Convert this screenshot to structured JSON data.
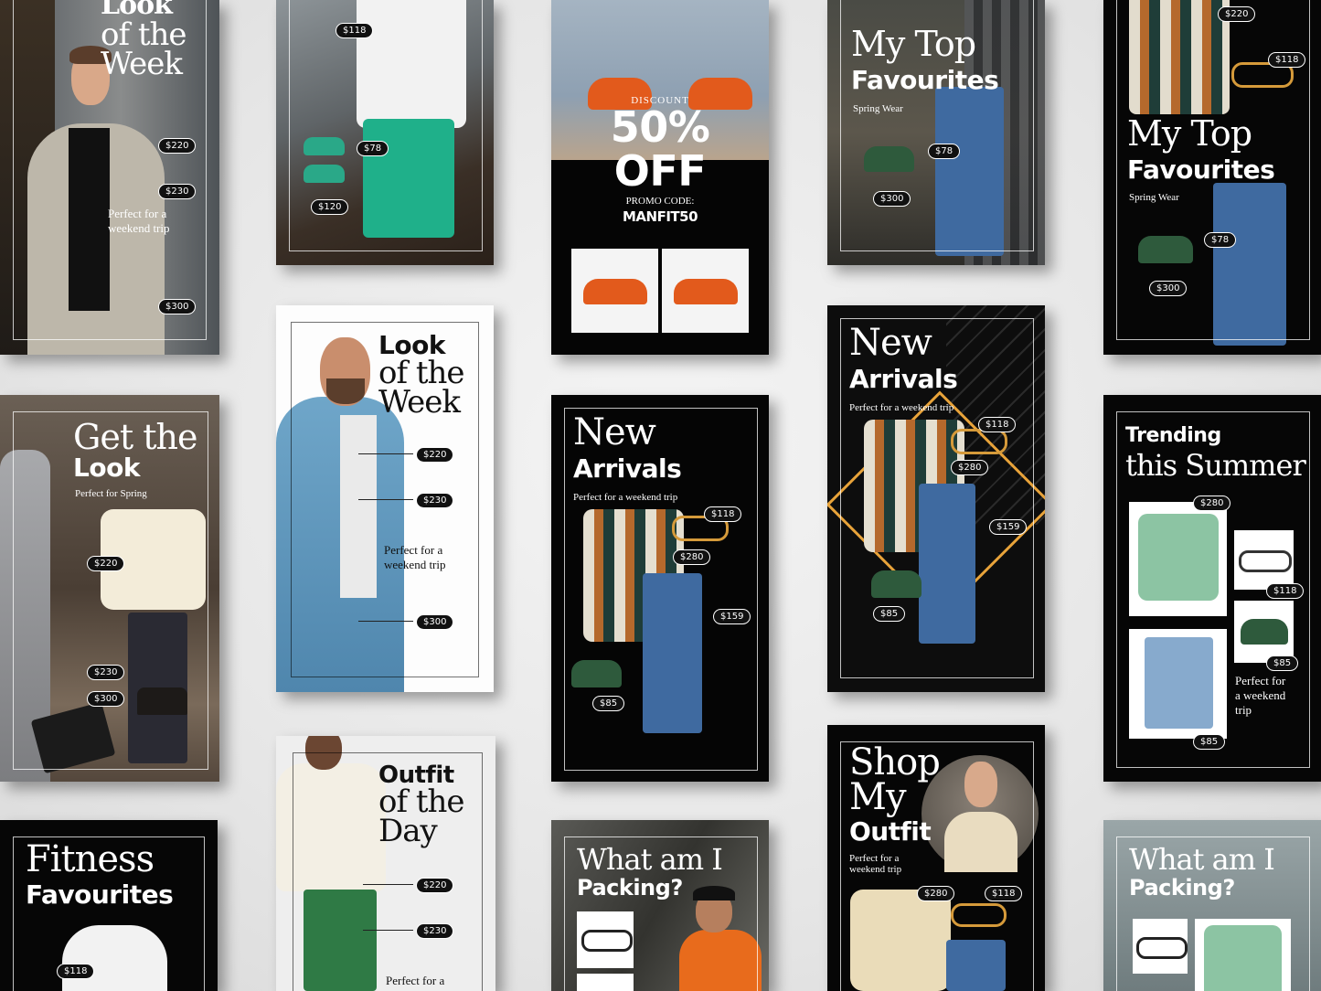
{
  "cards": {
    "c1": {
      "title_a": "Look",
      "title_b": "of the",
      "title_c": "Week",
      "note": "Perfect for a weekend trip",
      "prices": [
        "$220",
        "$230",
        "$300"
      ]
    },
    "c2": {
      "prices": [
        "$118",
        "$78",
        "$120"
      ]
    },
    "c3": {
      "label": "DISCOUNT",
      "big1": "50%",
      "big2": "OFF",
      "promo_label": "PROMO CODE:",
      "promo_code": "MANFIT50"
    },
    "c4": {
      "title_a": "My Top",
      "title_b": "Favourites",
      "sub": "Spring Wear",
      "prices": [
        "$78",
        "$300"
      ]
    },
    "c5": {
      "title_a": "My Top",
      "title_b": "Favourites",
      "sub": "Spring Wear",
      "prices": [
        "$220",
        "$118",
        "$78",
        "$300"
      ]
    },
    "c6": {
      "title_a": "Look",
      "title_b": "of the",
      "title_c": "Week",
      "note": "Perfect for a weekend trip",
      "prices": [
        "$220",
        "$230",
        "$300"
      ]
    },
    "c7": {
      "title_a": "Get the",
      "title_b": "Look",
      "sub": "Perfect for Spring",
      "prices": [
        "$220",
        "$230",
        "$300"
      ]
    },
    "c8": {
      "title_a": "New",
      "title_b": "Arrivals",
      "sub": "Perfect for a weekend trip",
      "prices": [
        "$118",
        "$280",
        "$159",
        "$85"
      ]
    },
    "c9": {
      "title_a": "New",
      "title_b": "Arrivals",
      "sub": "Perfect for a weekend trip",
      "prices": [
        "$118",
        "$280",
        "$159",
        "$85"
      ]
    },
    "c10": {
      "title_a": "Trending",
      "title_b": "this Summer",
      "note": "Perfect for a weekend trip",
      "prices": [
        "$280",
        "$118",
        "$85",
        "$85"
      ]
    },
    "c11": {
      "title_a": "Fitness",
      "title_b": "Favourites",
      "prices": [
        "$118"
      ]
    },
    "c12": {
      "title_a": "Outfit",
      "title_b": "of the",
      "title_c": "Day",
      "note": "Perfect for a",
      "prices": [
        "$220",
        "$230"
      ]
    },
    "c13": {
      "title_a": "What am I",
      "title_b": "Packing?"
    },
    "c14": {
      "title_a": "Shop",
      "title_b": "My",
      "title_c": "Outfit",
      "sub": "Perfect for a weekend trip",
      "prices": [
        "$280",
        "$118"
      ]
    },
    "c15": {
      "title_a": "What am I",
      "title_b": "Packing?"
    }
  },
  "colors": {
    "dark": "#0a0a0a",
    "accent_orange": "#e8a33a",
    "green": "#1fb08a",
    "denim": "#3f6aa0"
  }
}
